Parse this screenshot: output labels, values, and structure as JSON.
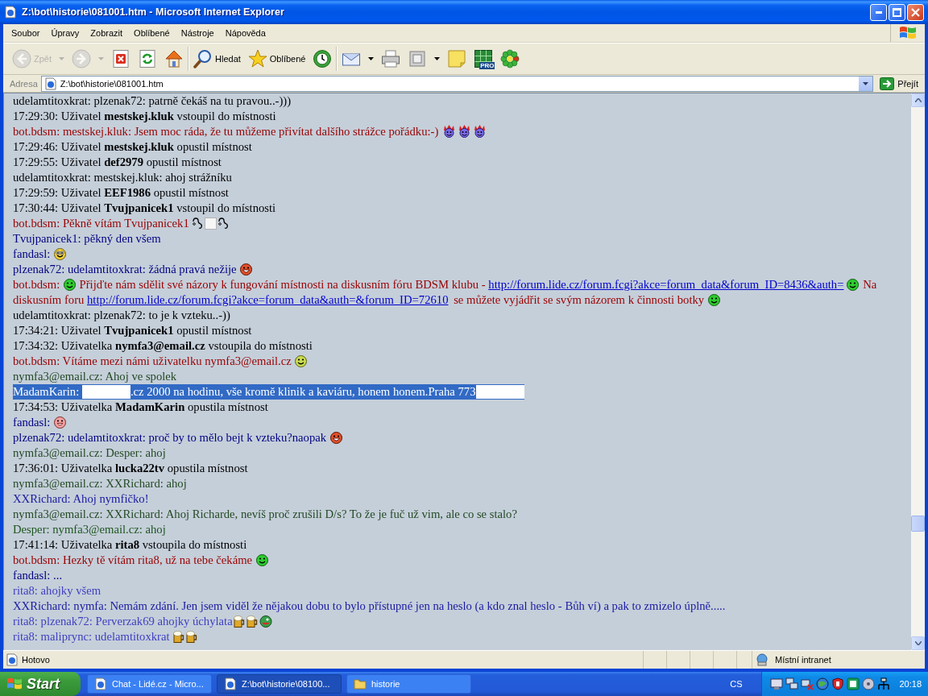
{
  "window": {
    "title": "Z:\\bot\\historie\\081001.htm - Microsoft Internet Explorer"
  },
  "menu": [
    "Soubor",
    "Úpravy",
    "Zobrazit",
    "Oblíbené",
    "Nástroje",
    "Nápověda"
  ],
  "toolbar": [
    {
      "items": [
        {
          "kind": "back",
          "label": "Zpět",
          "disabled": true,
          "dropdown": true
        },
        {
          "kind": "forward",
          "disabled": true,
          "dropdown": true
        },
        {
          "kind": "stop",
          "disabled": false,
          "dropdown": false
        },
        {
          "kind": "refresh",
          "disabled": false,
          "dropdown": false
        },
        {
          "kind": "home",
          "disabled": false,
          "dropdown": false
        }
      ]
    },
    {
      "items": [
        {
          "kind": "search",
          "label": "Hledat",
          "disabled": false,
          "dropdown": false
        },
        {
          "kind": "favorites",
          "label": "Oblíbené",
          "disabled": false,
          "dropdown": false
        },
        {
          "kind": "history",
          "disabled": false,
          "dropdown": false
        }
      ]
    },
    {
      "items": [
        {
          "kind": "mail",
          "disabled": false,
          "dropdown": true
        },
        {
          "kind": "print",
          "disabled": false,
          "dropdown": false
        },
        {
          "kind": "edit",
          "disabled": false,
          "dropdown": true
        },
        {
          "kind": "note",
          "disabled": false,
          "dropdown": false
        },
        {
          "kind": "pro",
          "badge": "PRO",
          "disabled": false,
          "dropdown": false
        },
        {
          "kind": "icq",
          "disabled": false,
          "dropdown": false
        }
      ]
    }
  ],
  "address": {
    "label": "Adresa",
    "value": "Z:\\bot\\historie\\081001.htm",
    "go": "Přejít"
  },
  "messages": [
    {
      "color": "#000000",
      "selected": false,
      "parts": [
        {
          "kind": "text",
          "text": "udelamtitoxkrat: plzenak72: patrně čekáš na tu pravou..-)))"
        }
      ]
    },
    {
      "color": "#000000",
      "selected": false,
      "parts": [
        {
          "kind": "text",
          "text": "17:29:30: Uživatel **mestskej.kluk** vstoupil do místnosti"
        }
      ]
    },
    {
      "color": "#990000",
      "selected": false,
      "parts": [
        {
          "kind": "text",
          "text": "bot.bdsm: mestskej.kluk: Jsem moc ráda, že tu můžeme přivítat dalšího strážce pořádku:-) "
        },
        {
          "kind": "crowned"
        },
        {
          "kind": "crowned"
        },
        {
          "kind": "crowned"
        }
      ]
    },
    {
      "color": "#000000",
      "selected": false,
      "parts": [
        {
          "kind": "text",
          "text": "17:29:46: Uživatel **mestskej.kluk** opustil místnost"
        }
      ]
    },
    {
      "color": "#000000",
      "selected": false,
      "parts": [
        {
          "kind": "text",
          "text": "17:29:55: Uživatel **def2979** opustil místnost"
        }
      ]
    },
    {
      "color": "#000000",
      "selected": false,
      "parts": [
        {
          "kind": "text",
          "text": "udelamtitoxkrat: mestskej.kluk: ahoj strážníku"
        }
      ]
    },
    {
      "color": "#000000",
      "selected": false,
      "parts": [
        {
          "kind": "text",
          "text": "17:29:59: Uživatel **EEF1986** opustil místnost"
        }
      ]
    },
    {
      "color": "#000000",
      "selected": false,
      "parts": [
        {
          "kind": "text",
          "text": "17:30:44: Uživatel **Tvujpanicek1** vstoupil do místnosti"
        }
      ]
    },
    {
      "color": "#990000",
      "selected": false,
      "parts": [
        {
          "kind": "text",
          "text": "bot.bdsm: Pěkně vítám Tvujpanicek1 "
        },
        {
          "kind": "chain"
        },
        {
          "kind": "blank"
        },
        {
          "kind": "chain"
        }
      ]
    },
    {
      "color": "#000080",
      "selected": false,
      "parts": [
        {
          "kind": "text",
          "text": "Tvujpanicek1: pěkný den všem"
        }
      ]
    },
    {
      "color": "#000080",
      "selected": false,
      "parts": [
        {
          "kind": "text",
          "text": "fandasl: "
        },
        {
          "kind": "smiley"
        }
      ]
    },
    {
      "color": "#000080",
      "selected": false,
      "parts": [
        {
          "kind": "text",
          "text": "plzenak72: udelamtitoxkrat: žádná pravá nežije "
        },
        {
          "kind": "laugh"
        }
      ]
    },
    {
      "color": "#990000",
      "selected": false,
      "parts": [
        {
          "kind": "text",
          "text": "bot.bdsm: "
        },
        {
          "kind": "green"
        },
        {
          "kind": "text",
          "text": " Přijďte nám sdělit své názory k fungování místnosti na diskusním fóru BDSM klubu - "
        },
        {
          "kind": "link",
          "text": "http://forum.lide.cz/forum.fcgi?akce=forum_data&forum_ID=8436&auth="
        },
        {
          "kind": "green"
        },
        {
          "kind": "text",
          "text": " Na diskusním foru "
        },
        {
          "kind": "link",
          "text": "http://forum.lide.cz/forum.fcgi?akce=forum_data&auth=&forum_ID=72610"
        },
        {
          "kind": "text",
          "text": " se můžete vyjádřit se svým názorem k činnosti botky "
        },
        {
          "kind": "green"
        }
      ]
    },
    {
      "color": "#000000",
      "selected": false,
      "parts": [
        {
          "kind": "text",
          "text": "udelamtitoxkrat: plzenak72: to je k vzteku..-))"
        }
      ]
    },
    {
      "color": "#000000",
      "selected": false,
      "parts": [
        {
          "kind": "text",
          "text": "17:34:21: Uživatel **Tvujpanicek1** opustil místnost"
        }
      ]
    },
    {
      "color": "#000000",
      "selected": false,
      "parts": [
        {
          "kind": "text",
          "text": "17:34:32: Uživatelka **nymfa3@email.cz** vstoupila do místnosti"
        }
      ]
    },
    {
      "color": "#990000",
      "selected": false,
      "parts": [
        {
          "kind": "text",
          "text": "bot.bdsm: Vítáme mezi námi uživatelku nymfa3@email.cz "
        },
        {
          "kind": "smile"
        }
      ]
    },
    {
      "color": "#244a24",
      "selected": false,
      "parts": [
        {
          "kind": "text",
          "text": "nymfa3@email.cz: Ahoj ve spolek"
        }
      ]
    },
    {
      "selected": true,
      "parts": [
        {
          "kind": "text",
          "text": "MadamKarin: "
        },
        {
          "kind": "redacted"
        },
        {
          "kind": "text",
          "text": ".cz 2000 na hodinu, vše kromě klinik a kaviáru, honem honem.Praha 773"
        },
        {
          "kind": "redacted"
        }
      ]
    },
    {
      "color": "#000000",
      "selected": false,
      "parts": [
        {
          "kind": "text",
          "text": "17:34:53: Uživatelka **MadamKarin** opustila místnost"
        }
      ]
    },
    {
      "color": "#000080",
      "selected": false,
      "parts": [
        {
          "kind": "text",
          "text": "fandasl: "
        },
        {
          "kind": "grin"
        }
      ]
    },
    {
      "color": "#000080",
      "selected": false,
      "parts": [
        {
          "kind": "text",
          "text": "plzenak72: udelamtitoxkrat: proč by to mělo bejt k vzteku?naopak "
        },
        {
          "kind": "laugh"
        }
      ]
    },
    {
      "color": "#244a24",
      "selected": false,
      "parts": [
        {
          "kind": "text",
          "text": "nymfa3@email.cz: Desper: ahoj"
        }
      ]
    },
    {
      "color": "#000000",
      "selected": false,
      "parts": [
        {
          "kind": "text",
          "text": "17:36:01: Uživatelka **lucka22tv** opustila místnost"
        }
      ]
    },
    {
      "color": "#244a24",
      "selected": false,
      "parts": [
        {
          "kind": "text",
          "text": "nymfa3@email.cz: XXRichard: ahoj"
        }
      ]
    },
    {
      "color": "#1a1aa0",
      "selected": false,
      "parts": [
        {
          "kind": "text",
          "text": "XXRichard: Ahoj nymfičko!"
        }
      ]
    },
    {
      "color": "#244a24",
      "selected": false,
      "parts": [
        {
          "kind": "text",
          "text": "nymfa3@email.cz: XXRichard: Ahoj Richarde, nevíš proč zrušili D/s? To že je fuč už vim, ale co se stalo?"
        }
      ]
    },
    {
      "color": "#1e561e",
      "selected": false,
      "parts": [
        {
          "kind": "text",
          "text": "Desper: nymfa3@email.cz: ahoj"
        }
      ]
    },
    {
      "color": "#000000",
      "selected": false,
      "parts": [
        {
          "kind": "text",
          "text": "17:41:14: Uživatelka **rita8** vstoupila do místnosti"
        }
      ]
    },
    {
      "color": "#990000",
      "selected": false,
      "parts": [
        {
          "kind": "text",
          "text": "bot.bdsm: Hezky tě vítám rita8, už na tebe čekáme "
        },
        {
          "kind": "green"
        }
      ]
    },
    {
      "color": "#000080",
      "selected": false,
      "parts": [
        {
          "kind": "text",
          "text": "fandasl: ..."
        }
      ]
    },
    {
      "color": "#4040c0",
      "selected": false,
      "parts": [
        {
          "kind": "text",
          "text": "rita8: ahojky všem"
        }
      ]
    },
    {
      "color": "#1a1aa0",
      "selected": false,
      "parts": [
        {
          "kind": "text",
          "text": "XXRichard: nymfa: Nemám zdání. Jen jsem viděl že nějakou dobu to bylo přístupné jen na heslo (a kdo znal heslo - Bůh ví) a pak to zmizelo úplně....."
        }
      ]
    },
    {
      "color": "#4040c0",
      "selected": false,
      "parts": [
        {
          "kind": "text",
          "text": "rita8: plzenak72: Perverzak69 ahojky úchylata"
        },
        {
          "kind": "beer"
        },
        {
          "kind": "beer"
        },
        {
          "kind": "ball"
        }
      ]
    },
    {
      "color": "#4040c0",
      "selected": false,
      "parts": [
        {
          "kind": "text",
          "text": "rita8: maliprync: udelamtitoxkrat "
        },
        {
          "kind": "beer"
        },
        {
          "kind": "beer"
        }
      ]
    }
  ],
  "status_bar": {
    "text": "Hotovo",
    "zone": "Místní intranet"
  },
  "taskbar": {
    "start": "Start",
    "tasks": [
      {
        "kind": "browser",
        "label": "Chat - Lidé.cz - Micro...",
        "selected": false
      },
      {
        "kind": "browser",
        "label": "Z:\\bot\\historie\\08100...",
        "selected": true
      },
      {
        "kind": "folder",
        "label": "historie",
        "selected": false
      }
    ],
    "language": "CS",
    "clock": "20:18"
  }
}
